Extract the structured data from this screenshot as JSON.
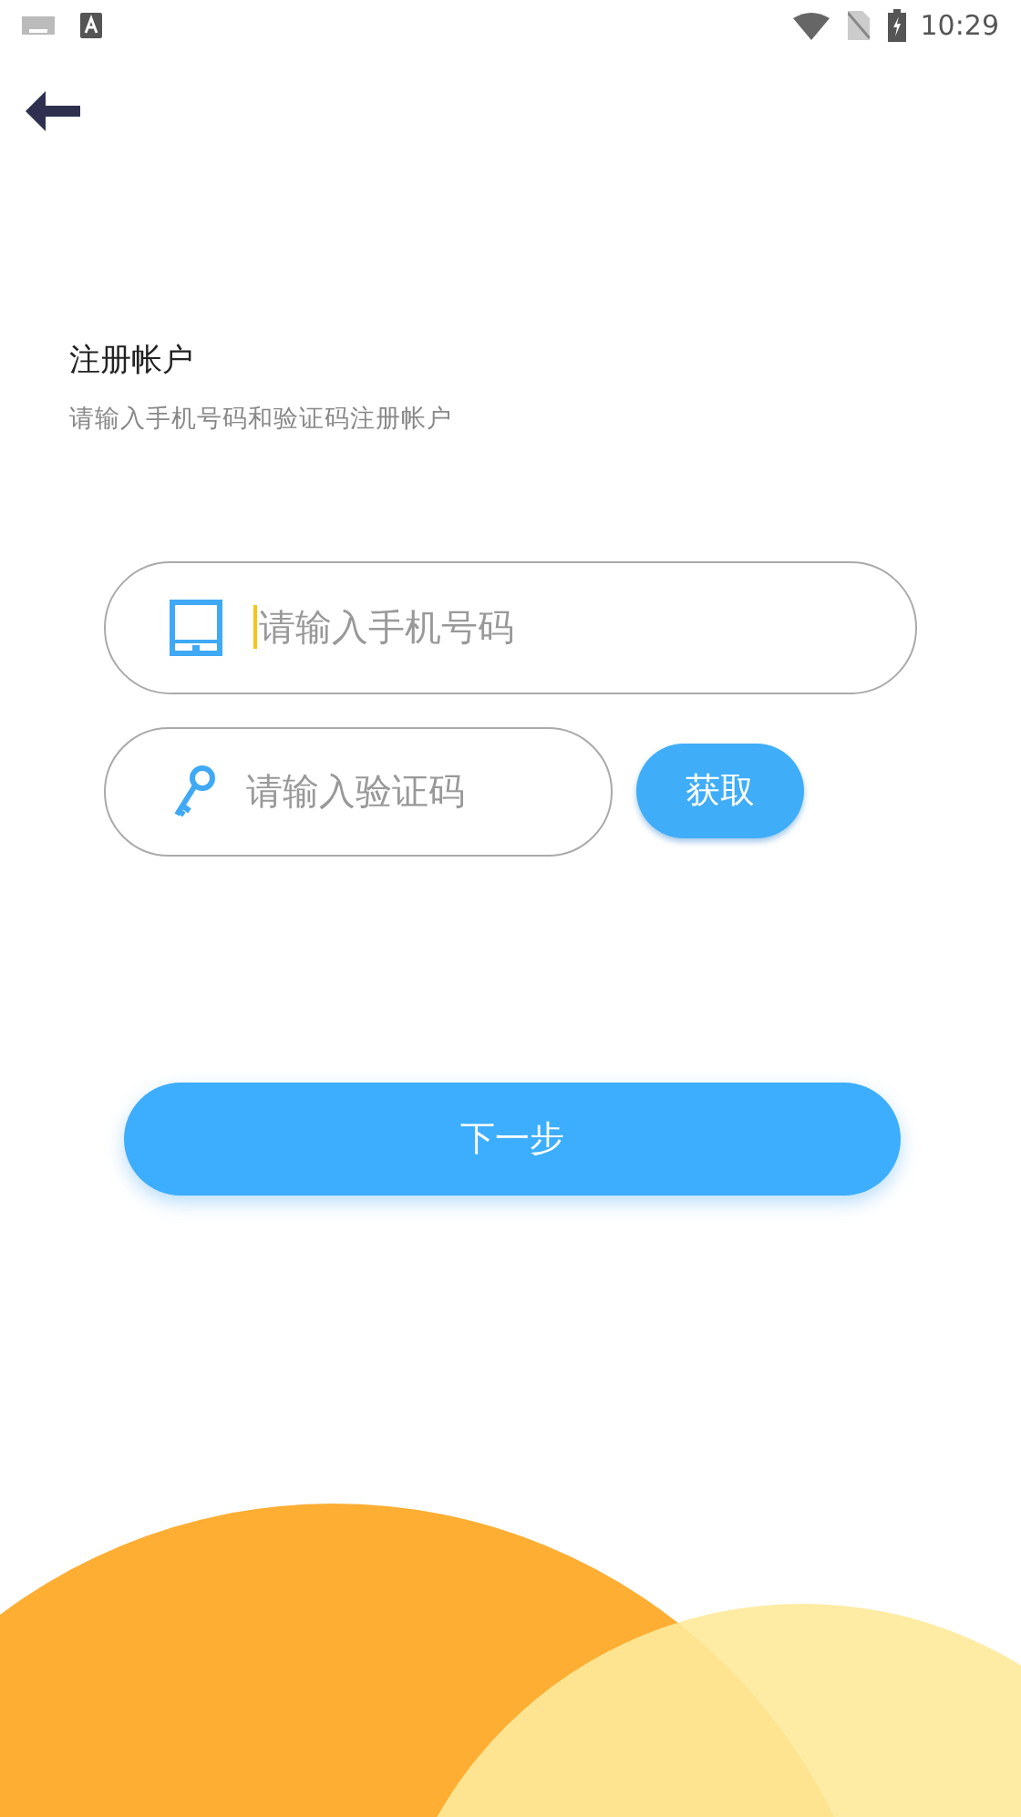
{
  "status_bar": {
    "time": "10:29"
  },
  "title": "注册帐户",
  "subtitle": "请输入手机号码和验证码注册帐户",
  "phone_field": {
    "placeholder": "请输入手机号码",
    "focused": true
  },
  "code_field": {
    "placeholder": "请输入验证码"
  },
  "get_code_button": "获取",
  "next_button": "下一步"
}
